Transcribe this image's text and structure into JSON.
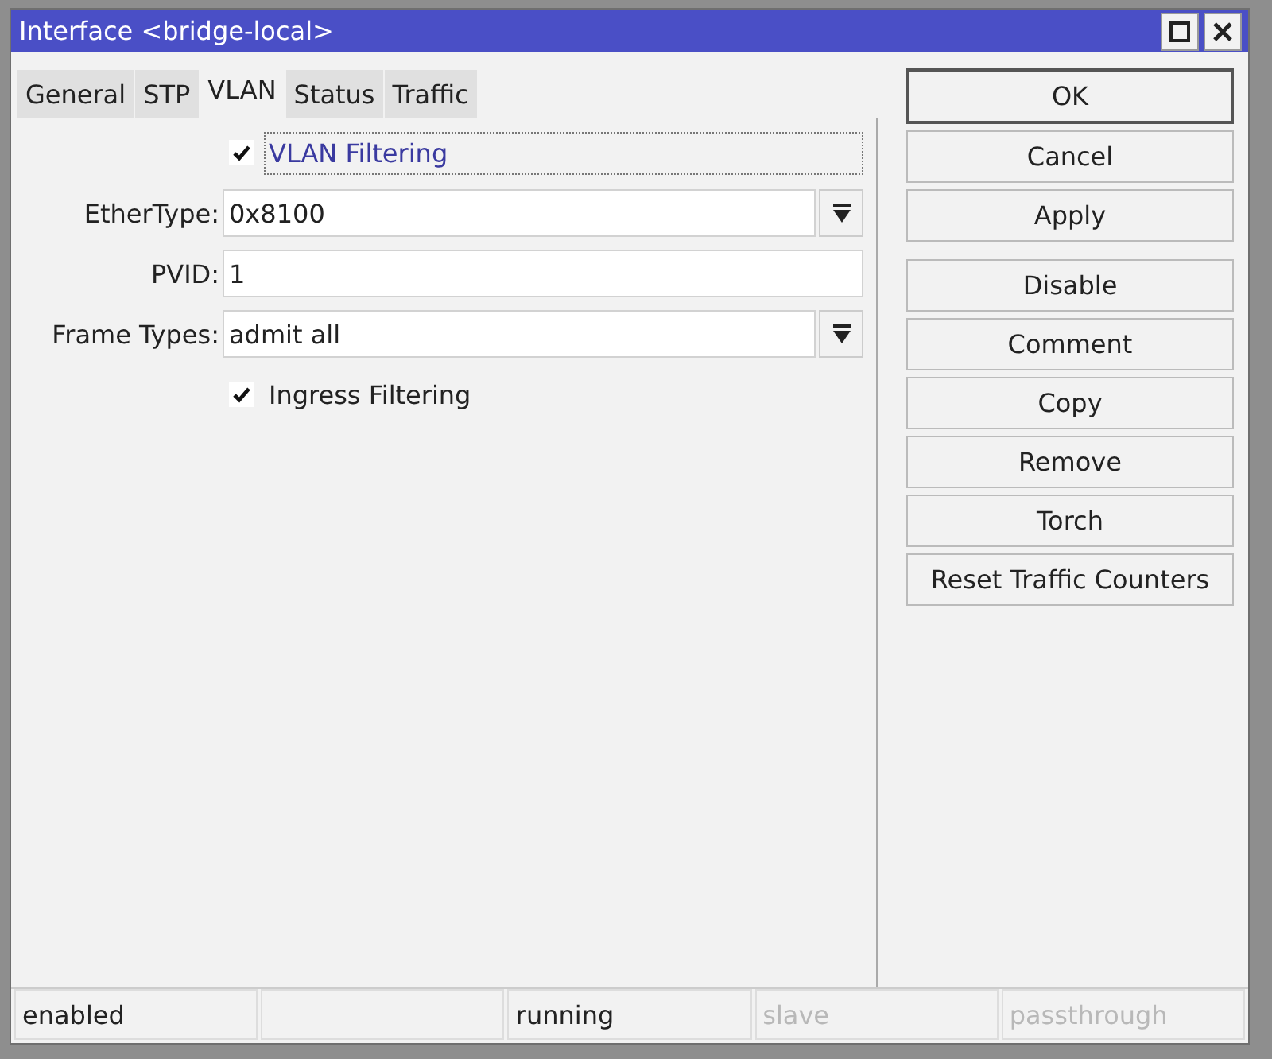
{
  "window": {
    "title": "Interface <bridge-local>"
  },
  "tabs": [
    {
      "label": "General",
      "selected": false
    },
    {
      "label": "STP",
      "selected": false
    },
    {
      "label": "VLAN",
      "selected": true
    },
    {
      "label": "Status",
      "selected": false
    },
    {
      "label": "Traffic",
      "selected": false
    }
  ],
  "fields": [
    {
      "kind": "checkbox",
      "label": "VLAN Filtering",
      "checked": true,
      "focused": true
    },
    {
      "kind": "dropdown",
      "label": "EtherType:",
      "value": "0x8100"
    },
    {
      "kind": "text",
      "label": "PVID:",
      "value": "1"
    },
    {
      "kind": "dropdown",
      "label": "Frame Types:",
      "value": "admit all"
    },
    {
      "kind": "checkbox",
      "label": "Ingress Filtering",
      "checked": true,
      "focused": false
    }
  ],
  "button_groups": [
    {
      "buttons": [
        {
          "label": "OK",
          "default": true
        },
        {
          "label": "Cancel",
          "default": false
        },
        {
          "label": "Apply",
          "default": false
        }
      ]
    },
    {
      "buttons": [
        {
          "label": "Disable",
          "default": false
        },
        {
          "label": "Comment",
          "default": false
        },
        {
          "label": "Copy",
          "default": false
        },
        {
          "label": "Remove",
          "default": false
        },
        {
          "label": "Torch",
          "default": false
        },
        {
          "label": "Reset Traffic Counters",
          "default": false
        }
      ]
    }
  ],
  "status_bar": [
    {
      "kind": "text",
      "text": "enabled",
      "disabled": false
    },
    {
      "kind": "empty"
    },
    {
      "kind": "text",
      "text": "running",
      "disabled": false
    },
    {
      "kind": "text",
      "text": "slave",
      "disabled": true
    },
    {
      "kind": "text",
      "text": "passthrough",
      "disabled": true
    }
  ]
}
